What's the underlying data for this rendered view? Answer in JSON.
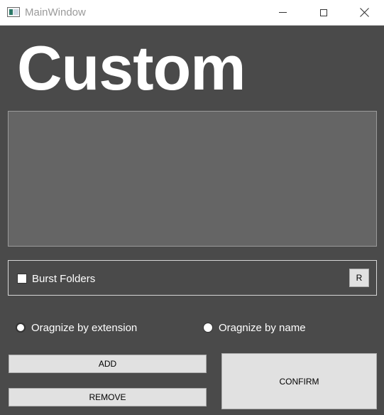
{
  "window": {
    "title": "MainWindow",
    "controls": {
      "minimize": "minimize-icon",
      "maximize": "maximize-icon",
      "close": "close-icon"
    }
  },
  "main": {
    "heading": "Custom",
    "list_view": {
      "items": []
    },
    "burst": {
      "checkbox_label": "Burst Folders",
      "checked": false,
      "reset_button_label": "R"
    },
    "organize": {
      "options": [
        {
          "label": "Oragnize by extension",
          "selected": true
        },
        {
          "label": "Oragnize by name",
          "selected": false
        }
      ]
    },
    "buttons": {
      "add_label": "ADD",
      "remove_label": "REMOVE",
      "confirm_label": "CONFIRM"
    }
  },
  "colors": {
    "background": "#4a4a4a",
    "list_background": "#656565",
    "button_face": "#e1e1e1",
    "text_light": "#ffffff"
  }
}
